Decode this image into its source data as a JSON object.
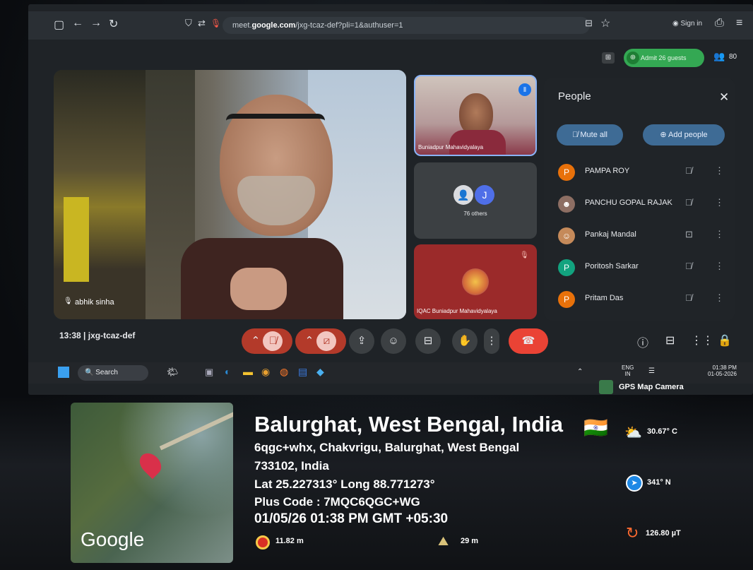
{
  "browser": {
    "url_prefix": "meet.",
    "url_domain": "google.com",
    "url_path": "/jxg-tcaz-def?pli=1&authuser=1",
    "sign_in": "Sign in",
    "icons": [
      "sidebar-icon",
      "back-arrow-icon",
      "forward-arrow-icon",
      "reload-icon"
    ]
  },
  "meet_header": {
    "admit_label": "Admit 26 guests",
    "participant_count": "80"
  },
  "main_tile": {
    "name": "abhik sinha"
  },
  "side_tiles": [
    {
      "name": "Buniadpur Mahavidyalaya"
    },
    {
      "avatar_letter": "J",
      "label": "76 others"
    },
    {
      "name": "IQAC Buniadpur Mahavidyalaya"
    }
  ],
  "people_panel": {
    "title": "People",
    "mute_all": "Mute all",
    "add_people": "Add people",
    "rows": [
      {
        "initial": "P",
        "name": "PAMPA ROY",
        "color": "#e8710a",
        "status": "muted"
      },
      {
        "initial": "",
        "name": "PANCHU GOPAL RAJAK",
        "color": "#8d6e63",
        "status": "muted"
      },
      {
        "initial": "",
        "name": "Pankaj Mandal",
        "color": "#c58a5a",
        "status": "presenting"
      },
      {
        "initial": "P",
        "name": "Poritosh Sarkar",
        "color": "#12a37f",
        "status": "muted"
      },
      {
        "initial": "P",
        "name": "Pritam Das",
        "color": "#e8710a",
        "status": "muted"
      }
    ]
  },
  "meeting_info": {
    "time": "13:38",
    "separator": "|",
    "code": "jxg-tcaz-def"
  },
  "taskbar": {
    "search": "Search",
    "lang": "ENG",
    "lang_sub": "IN",
    "time": "01:38 PM",
    "date": "01-05-2026"
  },
  "gps": {
    "brand": "GPS Map Camera",
    "title": "Balurghat, West Bengal, India",
    "address_line1": "6qgc+whx, Chakvrigu, Balurghat, West Bengal",
    "address_line2": "733102, India",
    "latlong": "Lat 25.227313° Long 88.771273°",
    "plus_code": "Plus Code : 7MQC6QGC+WG",
    "datetime": "01/05/26 01:38 PM GMT +05:30",
    "accuracy": "11.82 m",
    "altitude": "29 m",
    "temperature": "30.67° C",
    "heading": "341° N",
    "magnetic": "126.80 µT",
    "map_logo": "Google",
    "flag": "🇮🇳"
  }
}
